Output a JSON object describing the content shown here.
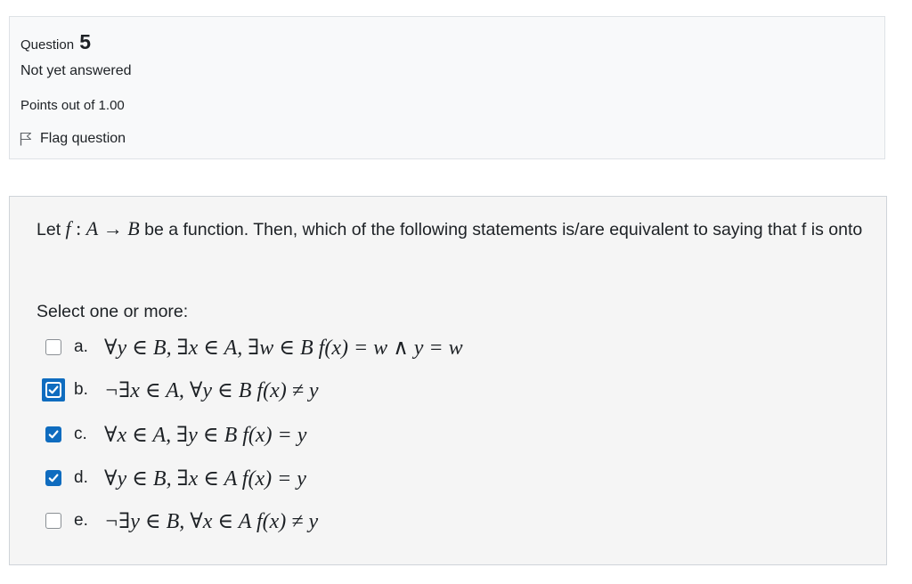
{
  "info": {
    "question_label": "Question",
    "question_number": "5",
    "state": "Not yet answered",
    "grade": "Points out of 1.00",
    "flag_label": "Flag question"
  },
  "question": {
    "text_prefix": "Let ",
    "math_f": "f",
    "math_colon": " : ",
    "math_A": "A",
    "math_arrow": " → ",
    "math_B": "B",
    "text_suffix": " be a function. Then, which of the following statements is/are equivalent to saying that f is onto",
    "prompt": "Select one or more:"
  },
  "options": [
    {
      "label": "a.",
      "formula": "∀y ∈ B, ∃x ∈ A, ∃w ∈ B f(x) = w ∧ y = w",
      "checked": false,
      "focused": false
    },
    {
      "label": "b.",
      "formula": "¬∃x ∈ A, ∀y ∈ B f(x) ≠ y",
      "checked": true,
      "focused": true
    },
    {
      "label": "c.",
      "formula": "∀x ∈ A, ∃y ∈ B f(x) = y",
      "checked": true,
      "focused": false
    },
    {
      "label": "d.",
      "formula": "∀y ∈ B, ∃x ∈ A f(x) = y",
      "checked": true,
      "focused": false
    },
    {
      "label": "e.",
      "formula": "¬∃y ∈ B, ∀x ∈ A f(x) ≠ y",
      "checked": false,
      "focused": false
    }
  ],
  "colors": {
    "accent": "#0f6cbf",
    "info_bg": "#f8f9fa",
    "content_bg": "#f5f5f5"
  },
  "icons": {
    "flag": "flag-icon",
    "checkbox_tick": "check-icon"
  }
}
